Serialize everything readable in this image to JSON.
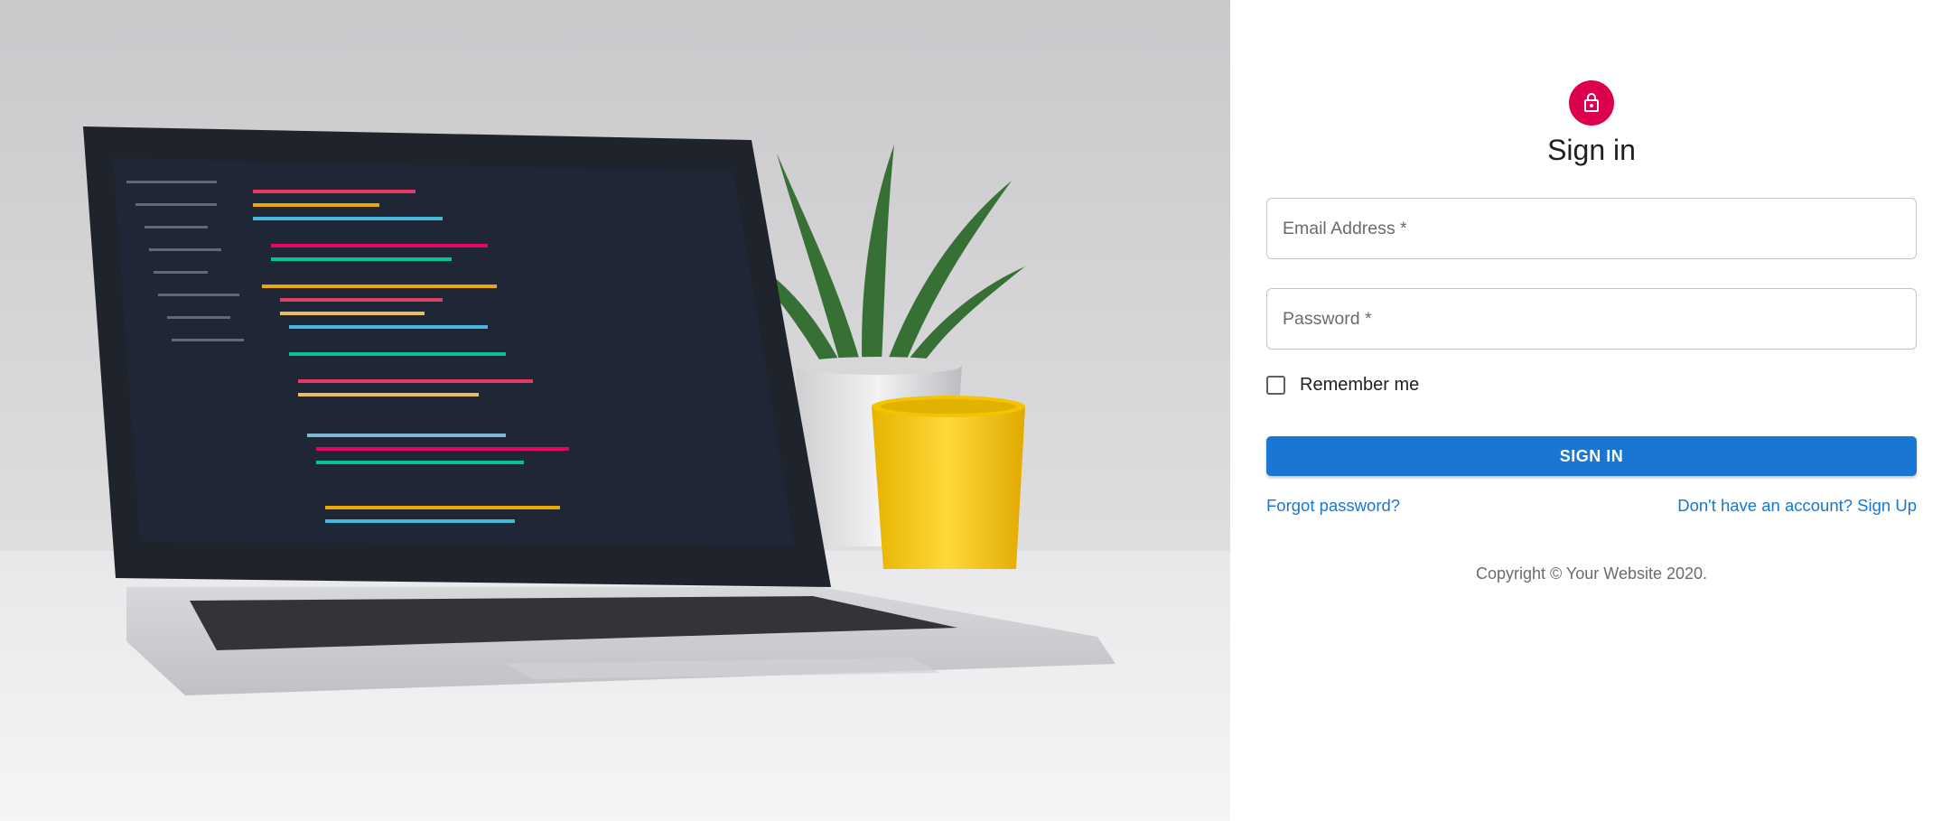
{
  "signin": {
    "title": "Sign in",
    "email_placeholder": "Email Address *",
    "password_placeholder": "Password *",
    "remember_label": "Remember me",
    "submit_label": "SIGN IN",
    "forgot_link": "Forgot password?",
    "signup_link": "Don't have an account? Sign Up",
    "copyright": "Copyright © Your Website 2020."
  },
  "colors": {
    "avatar_bg": "#dc004e",
    "primary": "#1976d2"
  },
  "icons": {
    "avatar_icon": "lock-outlined-icon"
  }
}
